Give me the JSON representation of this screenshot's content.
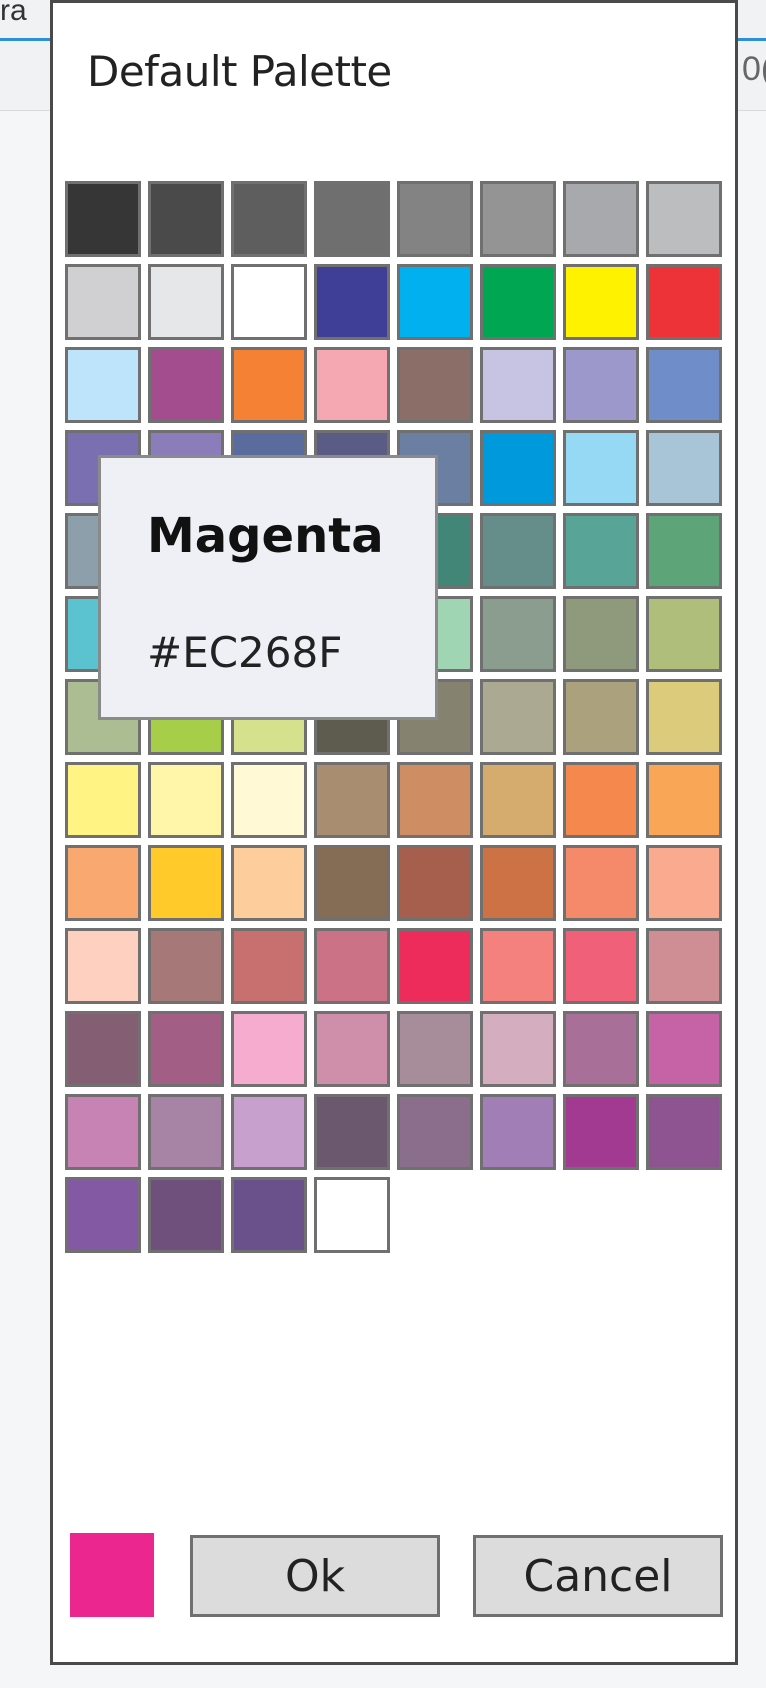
{
  "background": {
    "left_fragment": "ra",
    "right_fragment": "0("
  },
  "dialog": {
    "title": "Default Palette"
  },
  "palette": {
    "swatches": [
      "#363636",
      "#4a4a4a",
      "#5e5e5e",
      "#6f6f6f",
      "#838383",
      "#949494",
      "#a8a9ad",
      "#bcbdbf",
      "#d0d0d2",
      "#e6e7e8",
      "#ffffff",
      "#3f3f97",
      "#00b0ef",
      "#00a651",
      "#fff200",
      "#ee3338",
      "#bde4fb",
      "#a44d8e",
      "#f48134",
      "#f6a8b2",
      "#8a6e67",
      "#c7c3e2",
      "#9d98cb",
      "#6f8dc9",
      "#7a6fb1",
      "#8a7dba",
      "#5a6b9e",
      "#5a5c86",
      "#6b7fa3",
      "#009adc",
      "#95d9f4",
      "#a7c5d6",
      "#8c9fab",
      "#6d8b90",
      "#5a9490",
      "#437f74",
      "#428677",
      "#658e8a",
      "#58a598",
      "#5ea479",
      "#5bc3cf",
      "#72c4b8",
      "#7ec79f",
      "#8bd0b2",
      "#9fd5b3",
      "#8a9d8f",
      "#8e9a7b",
      "#afbe7a",
      "#adbd93",
      "#a6ce48",
      "#d5e18d",
      "#5d5c4e",
      "#858270",
      "#aca992",
      "#aba27d",
      "#dbcb7a",
      "#fff384",
      "#fff6aa",
      "#fff9d6",
      "#a88d71",
      "#cf8d63",
      "#d6ac6e",
      "#f5884c",
      "#f9a756",
      "#f9a86f",
      "#ffca2a",
      "#fdcd9c",
      "#846d54",
      "#a65f4d",
      "#cd7245",
      "#f58a6b",
      "#f9aa8f",
      "#fdd0bf",
      "#a77878",
      "#c87070",
      "#cc7286",
      "#ed2c5b",
      "#f4817e",
      "#f06079",
      "#ce8e94",
      "#845f73",
      "#a25e85",
      "#f6acce",
      "#cf8faa",
      "#a78d9a",
      "#d4aebf",
      "#a87098",
      "#c663a6",
      "#c883b5",
      "#a783a6",
      "#c8a0ce",
      "#6b576e",
      "#8a6e8c",
      "#a27eb7",
      "#a33a92",
      "#8d5491",
      "#8359a3",
      "#6f507d",
      "#6b518b",
      "#ffffff"
    ]
  },
  "tooltip": {
    "name": "Magenta",
    "hex": "#EC268F"
  },
  "selected": {
    "color": "#EC268F"
  },
  "buttons": {
    "ok_label": "Ok",
    "cancel_label": "Cancel"
  }
}
